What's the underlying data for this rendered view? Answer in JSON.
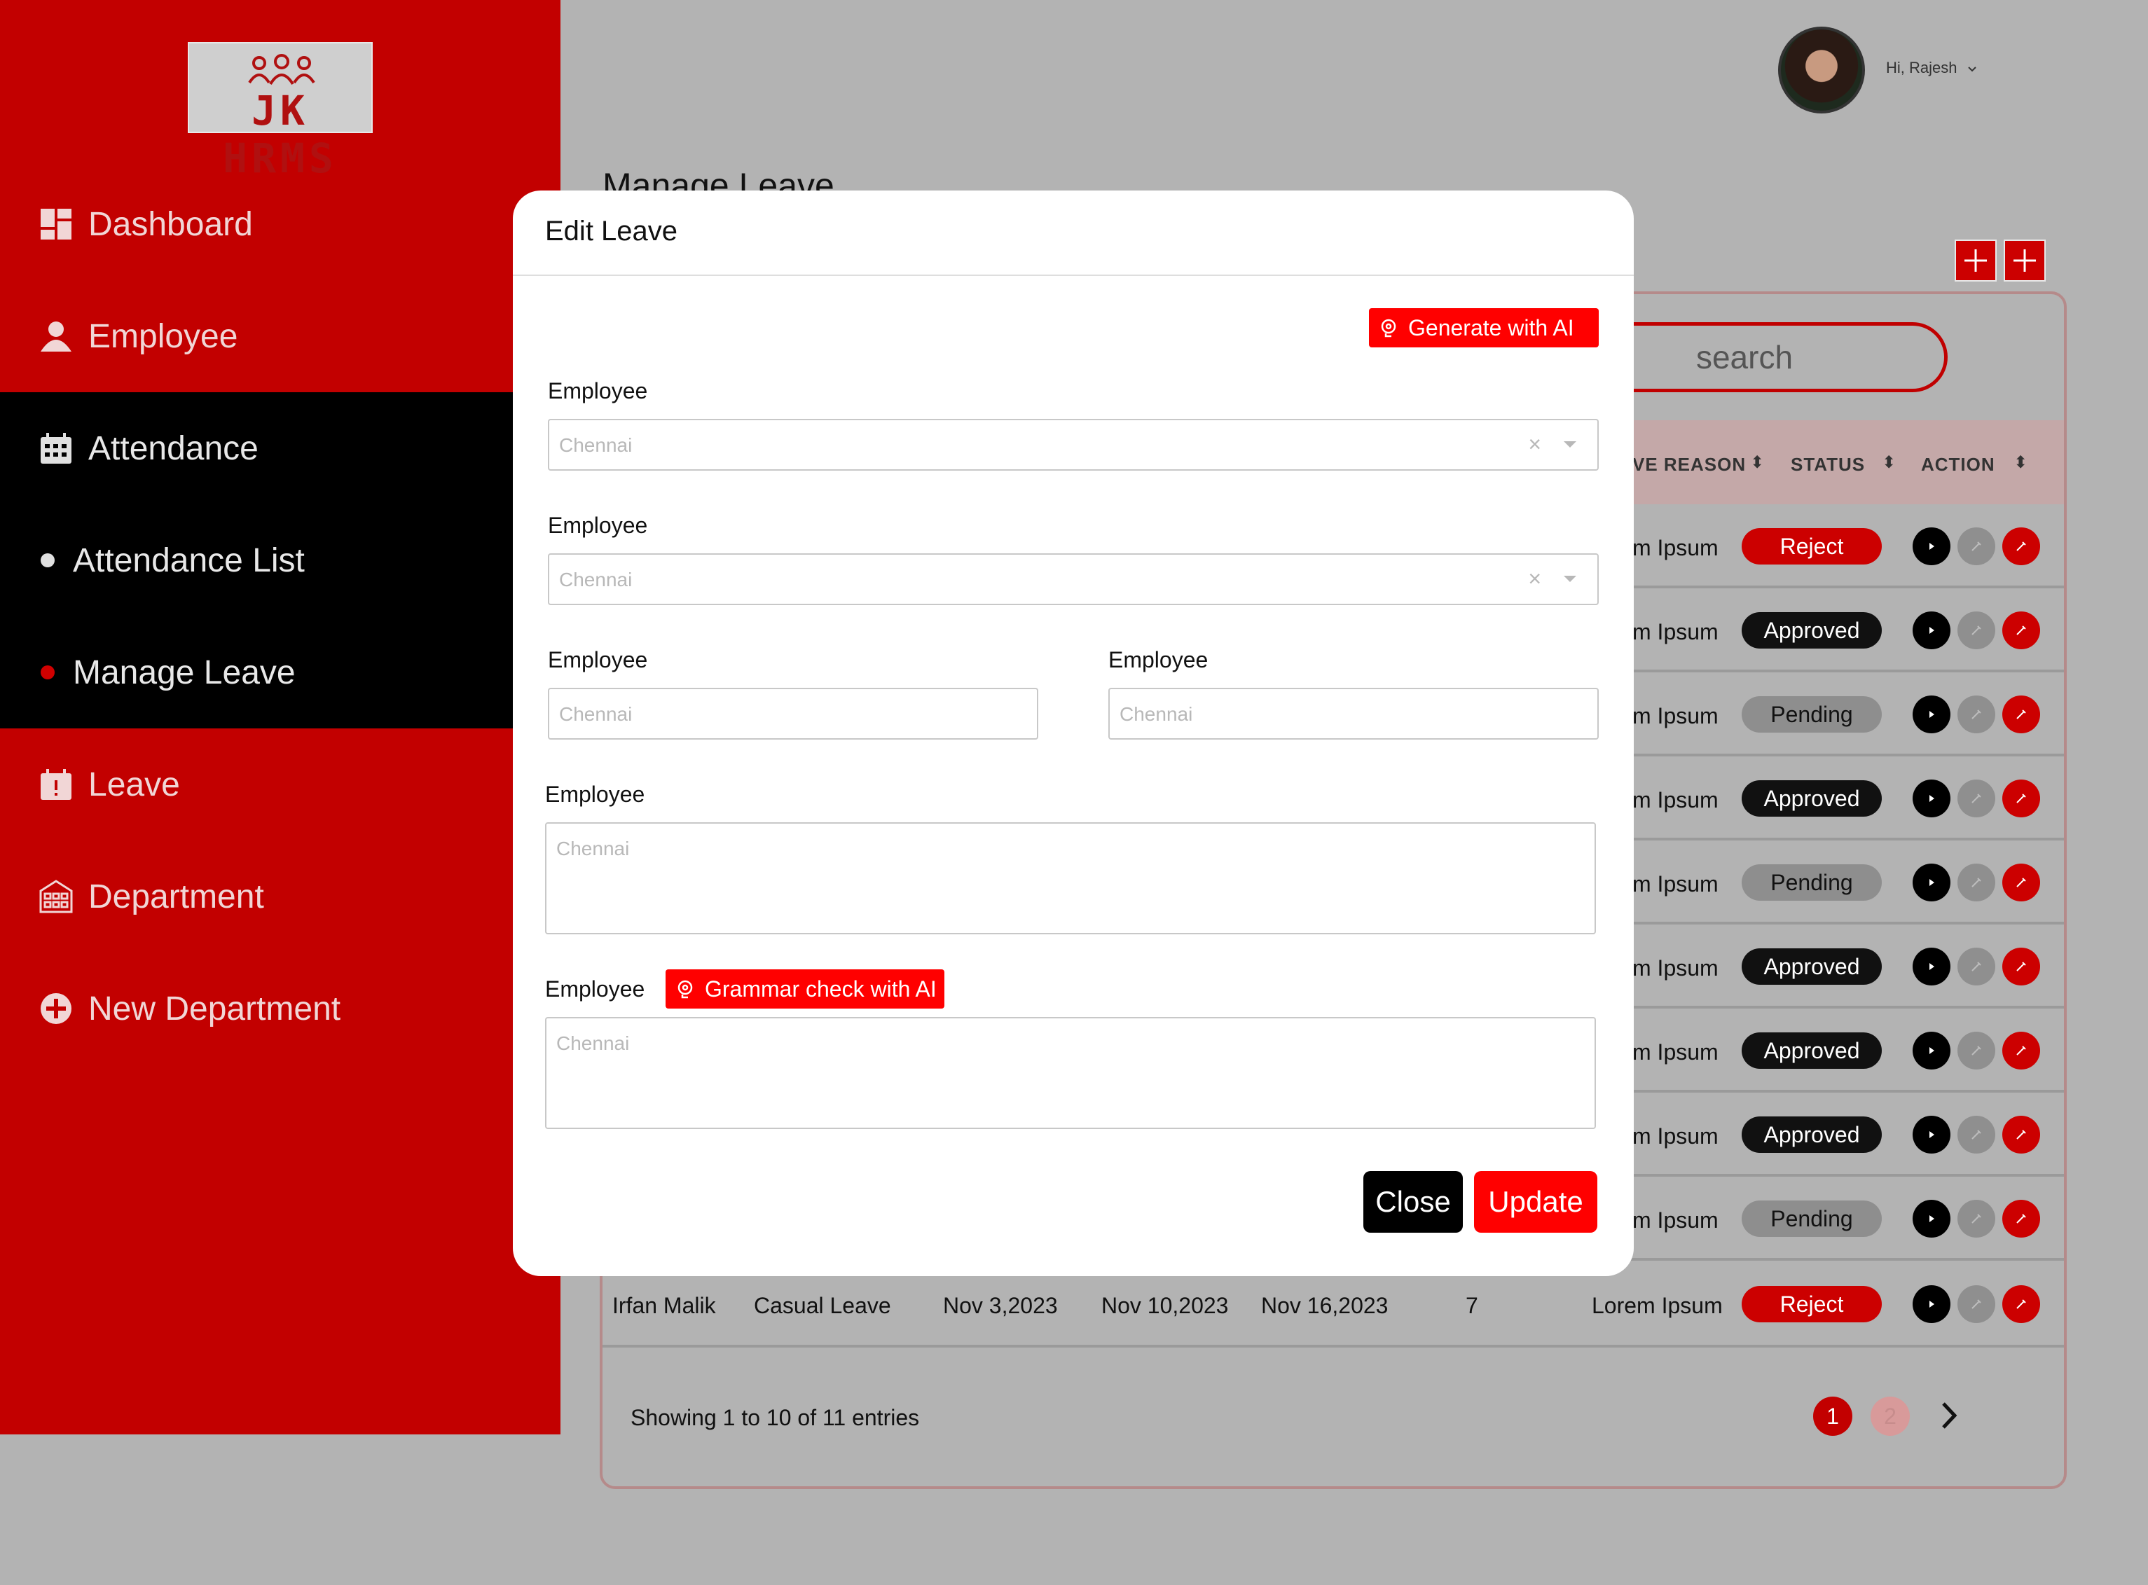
{
  "brand": {
    "logo_text": "JK HRMS"
  },
  "sidebar": {
    "items": [
      {
        "label": "Dashboard",
        "icon": "dashboard-icon"
      },
      {
        "label": "Employee",
        "icon": "user-icon"
      },
      {
        "label": "Attendance",
        "icon": "calendar-icon"
      },
      {
        "label": "Leave",
        "icon": "calendar-alert-icon"
      },
      {
        "label": "Department",
        "icon": "building-icon"
      },
      {
        "label": "New Department",
        "icon": "plus-circle-icon"
      }
    ],
    "sub_items": [
      {
        "label": "Attendance List"
      },
      {
        "label": "Manage Leave"
      }
    ]
  },
  "header": {
    "greeting": "Hi, Rajesh"
  },
  "page": {
    "title": "Manage Leave",
    "search_text": "search",
    "columns": [
      {
        "label": "VE REASON"
      },
      {
        "label": "STATUS"
      },
      {
        "label": "ACTION"
      }
    ],
    "rows": [
      {
        "reason": "m Ipsum",
        "status": "Reject"
      },
      {
        "reason": "m Ipsum",
        "status": "Approved"
      },
      {
        "reason": "m Ipsum",
        "status": "Pending"
      },
      {
        "reason": "m Ipsum",
        "status": "Approved"
      },
      {
        "reason": "m Ipsum",
        "status": "Pending"
      },
      {
        "reason": "m Ipsum",
        "status": "Approved"
      },
      {
        "reason": "m Ipsum",
        "status": "Approved"
      },
      {
        "reason": "m Ipsum",
        "status": "Approved"
      },
      {
        "reason": "m Ipsum",
        "status": "Pending"
      }
    ],
    "last_row": {
      "name": "Irfan Malik",
      "type": "Casual Leave",
      "applied": "Nov 3,2023",
      "from": "Nov 10,2023",
      "to": "Nov 16,2023",
      "days": "7",
      "reason": "Lorem Ipsum",
      "status": "Reject"
    },
    "footer": "Showing 1 to 10 of 11 entries",
    "pages": [
      "1",
      "2"
    ]
  },
  "modal": {
    "title": "Edit Leave",
    "generate_ai_label": "Generate with AI",
    "grammar_ai_label": "Grammar check with AI",
    "fields": [
      {
        "label": "Employee",
        "placeholder": "Chennai"
      },
      {
        "label": "Employee",
        "placeholder": "Chennai"
      },
      {
        "label": "Employee",
        "placeholder": "Chennai"
      },
      {
        "label": "Employee",
        "placeholder": "Chennai"
      },
      {
        "label": "Employee",
        "placeholder": "Chennai"
      },
      {
        "label": "Employee",
        "placeholder": "Chennai"
      }
    ],
    "clear_symbol": "×",
    "close_label": "Close",
    "update_label": "Update"
  },
  "colors": {
    "brand_red": "#c20000",
    "accent_red": "#ff0000",
    "nav_active": "#000000",
    "overlay_gray": "#b3b3b3"
  }
}
